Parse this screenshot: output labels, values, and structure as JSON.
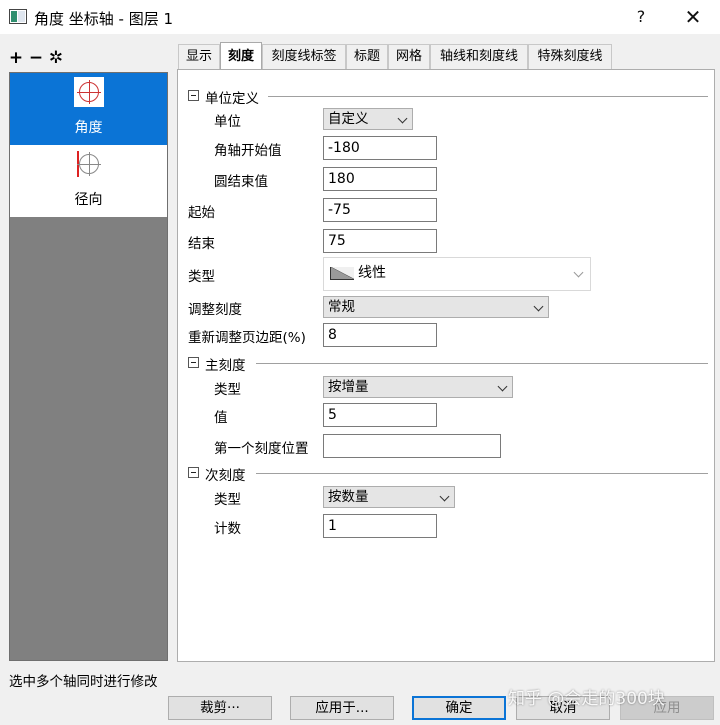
{
  "window": {
    "title": "角度 坐标轴 - 图层 1",
    "help": "?",
    "close": "✕"
  },
  "toolbar": {
    "add": "+",
    "remove": "−",
    "settings": "✲"
  },
  "axes": [
    {
      "label": "角度",
      "selected": true
    },
    {
      "label": "径向",
      "selected": false
    }
  ],
  "tabs": [
    "显示",
    "刻度",
    "刻度线标签",
    "标题",
    "网格",
    "轴线和刻度线",
    "特殊刻度线"
  ],
  "active_tab": "刻度",
  "unit_section": {
    "title": "单位定义",
    "unit_label": "单位",
    "unit_value": "自定义",
    "angle_start_label": "角轴开始值",
    "angle_start_value": "-180",
    "circle_end_label": "圆结束值",
    "circle_end_value": "180"
  },
  "range": {
    "start_label": "起始",
    "start_value": "-75",
    "end_label": "结束",
    "end_value": "75",
    "type_label": "类型",
    "type_value": "线性",
    "rescale_label": "调整刻度",
    "rescale_value": "常规",
    "margin_label": "重新调整页边距(%)",
    "margin_value": "8"
  },
  "major_ticks": {
    "title": "主刻度",
    "type_label": "类型",
    "type_value": "按增量",
    "value_label": "值",
    "value": "5",
    "first_tick_label": "第一个刻度位置",
    "first_tick_value": ""
  },
  "minor_ticks": {
    "title": "次刻度",
    "type_label": "类型",
    "type_value": "按数量",
    "count_label": "计数",
    "count_value": "1"
  },
  "status": "选中多个轴同时进行修改",
  "buttons": {
    "crop": "裁剪···",
    "apply_to": "应用于...",
    "ok": "确定",
    "cancel": "取消",
    "apply": "应用"
  },
  "watermark": "知乎 @会走的300块",
  "colors": {
    "selection": "#0b74d6",
    "panel_gray": "#808080"
  }
}
